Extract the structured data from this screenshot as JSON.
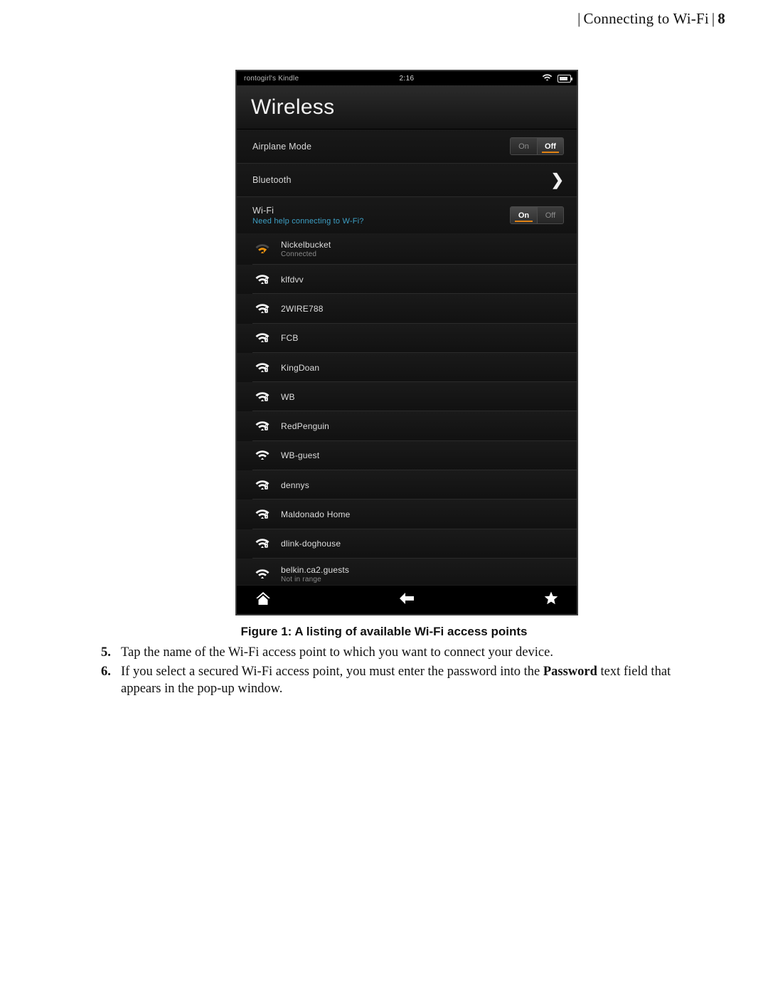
{
  "running_head": {
    "bar_left": "|",
    "title": "Connecting to Wi-Fi",
    "bar_right": "|",
    "page_number": "8"
  },
  "device": {
    "statusbar": {
      "owner": "rontogirl's Kindle",
      "time": "2:16",
      "wifi_icon": "wifi-icon",
      "battery_icon": "battery-icon"
    },
    "screen_title": "Wireless",
    "settings_rows": [
      {
        "label": "Airplane Mode",
        "control": "toggle",
        "options": [
          "On",
          "Off"
        ],
        "selected": "Off"
      },
      {
        "label": "Bluetooth",
        "control": "chevron",
        "chevron": "❯"
      },
      {
        "label": "Wi-Fi",
        "sub_link": "Need help connecting to W-Fi?",
        "control": "toggle",
        "options": [
          "On",
          "Off"
        ],
        "selected": "On"
      }
    ],
    "networks": [
      {
        "name": "Nickelbucket",
        "status": "Connected",
        "secured": false,
        "connected": true
      },
      {
        "name": "klfdvv",
        "status": "",
        "secured": true,
        "connected": false
      },
      {
        "name": "2WIRE788",
        "status": "",
        "secured": true,
        "connected": false
      },
      {
        "name": "FCB",
        "status": "",
        "secured": true,
        "connected": false
      },
      {
        "name": "KingDoan",
        "status": "",
        "secured": true,
        "connected": false
      },
      {
        "name": "WB",
        "status": "",
        "secured": true,
        "connected": false
      },
      {
        "name": "RedPenguin",
        "status": "",
        "secured": true,
        "connected": false
      },
      {
        "name": "WB-guest",
        "status": "",
        "secured": false,
        "connected": false
      },
      {
        "name": "dennys",
        "status": "",
        "secured": true,
        "connected": false
      },
      {
        "name": "Maldonado Home",
        "status": "",
        "secured": true,
        "connected": false
      },
      {
        "name": "dlink-doghouse",
        "status": "",
        "secured": true,
        "connected": false
      },
      {
        "name": "belkin.ca2.guests",
        "status": "Not in range",
        "secured": false,
        "connected": false
      }
    ],
    "navbar": [
      {
        "icon": "home-icon"
      },
      {
        "icon": "back-arrow-icon"
      },
      {
        "icon": "star-icon"
      }
    ]
  },
  "figure_caption": "Figure 1: A listing of available Wi-Fi access points",
  "steps": [
    {
      "num": "5.",
      "text_before": "Tap the name of the Wi-Fi access point to which you want to connect your device.",
      "bold": "",
      "text_after": ""
    },
    {
      "num": "6.",
      "text_before": "If you select a secured Wi-Fi access point, you must enter the password into the ",
      "bold": "Password",
      "text_after": " text field that appears in the pop-up window."
    }
  ],
  "colors": {
    "accent_orange": "#e08214",
    "link_blue": "#3d9fc4",
    "screen_bg": "#121212"
  }
}
